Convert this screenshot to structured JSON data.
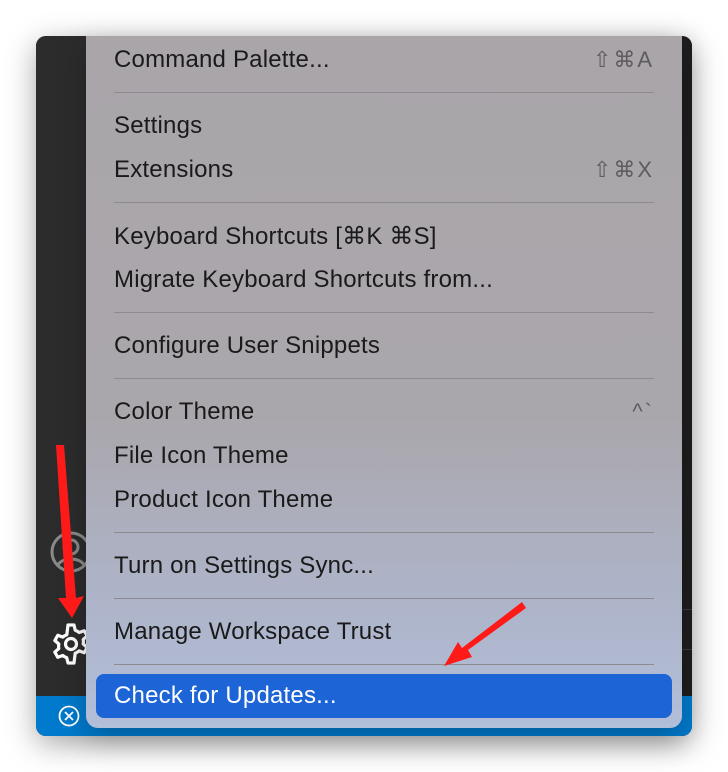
{
  "menu": {
    "groups": [
      [
        {
          "label": "Command Palette...",
          "shortcut": "⇧⌘A"
        }
      ],
      [
        {
          "label": "Settings",
          "shortcut": ""
        },
        {
          "label": "Extensions",
          "shortcut": "⇧⌘X"
        }
      ],
      [
        {
          "label": "Keyboard Shortcuts [⌘K ⌘S]",
          "shortcut": ""
        },
        {
          "label": "Migrate Keyboard Shortcuts from...",
          "shortcut": ""
        }
      ],
      [
        {
          "label": "Configure User Snippets",
          "shortcut": ""
        }
      ],
      [
        {
          "label": "Color Theme",
          "shortcut": "^`"
        },
        {
          "label": "File Icon Theme",
          "shortcut": ""
        },
        {
          "label": "Product Icon Theme",
          "shortcut": ""
        }
      ],
      [
        {
          "label": "Turn on Settings Sync...",
          "shortcut": ""
        }
      ],
      [
        {
          "label": "Manage Workspace Trust",
          "shortcut": ""
        }
      ]
    ],
    "highlighted": {
      "label": "Check for Updates..."
    }
  },
  "colors": {
    "highlight": "#1d64d6",
    "status_bar": "#007acc",
    "annotation_arrow": "#ff1a1a"
  },
  "icons": [
    "account-icon",
    "gear-icon",
    "remote-icon"
  ]
}
